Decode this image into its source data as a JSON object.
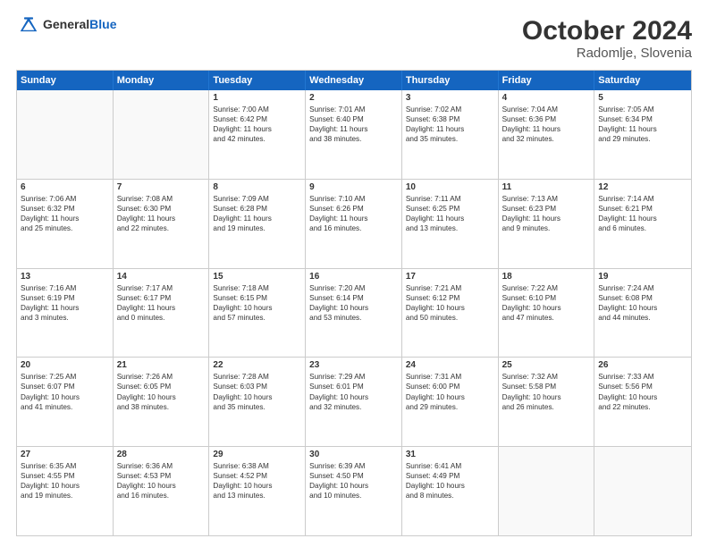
{
  "logo": {
    "general": "General",
    "blue": "Blue"
  },
  "title": "October 2024",
  "location": "Radomlje, Slovenia",
  "header_days": [
    "Sunday",
    "Monday",
    "Tuesday",
    "Wednesday",
    "Thursday",
    "Friday",
    "Saturday"
  ],
  "weeks": [
    [
      {
        "day": "",
        "lines": []
      },
      {
        "day": "",
        "lines": []
      },
      {
        "day": "1",
        "lines": [
          "Sunrise: 7:00 AM",
          "Sunset: 6:42 PM",
          "Daylight: 11 hours",
          "and 42 minutes."
        ]
      },
      {
        "day": "2",
        "lines": [
          "Sunrise: 7:01 AM",
          "Sunset: 6:40 PM",
          "Daylight: 11 hours",
          "and 38 minutes."
        ]
      },
      {
        "day": "3",
        "lines": [
          "Sunrise: 7:02 AM",
          "Sunset: 6:38 PM",
          "Daylight: 11 hours",
          "and 35 minutes."
        ]
      },
      {
        "day": "4",
        "lines": [
          "Sunrise: 7:04 AM",
          "Sunset: 6:36 PM",
          "Daylight: 11 hours",
          "and 32 minutes."
        ]
      },
      {
        "day": "5",
        "lines": [
          "Sunrise: 7:05 AM",
          "Sunset: 6:34 PM",
          "Daylight: 11 hours",
          "and 29 minutes."
        ]
      }
    ],
    [
      {
        "day": "6",
        "lines": [
          "Sunrise: 7:06 AM",
          "Sunset: 6:32 PM",
          "Daylight: 11 hours",
          "and 25 minutes."
        ]
      },
      {
        "day": "7",
        "lines": [
          "Sunrise: 7:08 AM",
          "Sunset: 6:30 PM",
          "Daylight: 11 hours",
          "and 22 minutes."
        ]
      },
      {
        "day": "8",
        "lines": [
          "Sunrise: 7:09 AM",
          "Sunset: 6:28 PM",
          "Daylight: 11 hours",
          "and 19 minutes."
        ]
      },
      {
        "day": "9",
        "lines": [
          "Sunrise: 7:10 AM",
          "Sunset: 6:26 PM",
          "Daylight: 11 hours",
          "and 16 minutes."
        ]
      },
      {
        "day": "10",
        "lines": [
          "Sunrise: 7:11 AM",
          "Sunset: 6:25 PM",
          "Daylight: 11 hours",
          "and 13 minutes."
        ]
      },
      {
        "day": "11",
        "lines": [
          "Sunrise: 7:13 AM",
          "Sunset: 6:23 PM",
          "Daylight: 11 hours",
          "and 9 minutes."
        ]
      },
      {
        "day": "12",
        "lines": [
          "Sunrise: 7:14 AM",
          "Sunset: 6:21 PM",
          "Daylight: 11 hours",
          "and 6 minutes."
        ]
      }
    ],
    [
      {
        "day": "13",
        "lines": [
          "Sunrise: 7:16 AM",
          "Sunset: 6:19 PM",
          "Daylight: 11 hours",
          "and 3 minutes."
        ]
      },
      {
        "day": "14",
        "lines": [
          "Sunrise: 7:17 AM",
          "Sunset: 6:17 PM",
          "Daylight: 11 hours",
          "and 0 minutes."
        ]
      },
      {
        "day": "15",
        "lines": [
          "Sunrise: 7:18 AM",
          "Sunset: 6:15 PM",
          "Daylight: 10 hours",
          "and 57 minutes."
        ]
      },
      {
        "day": "16",
        "lines": [
          "Sunrise: 7:20 AM",
          "Sunset: 6:14 PM",
          "Daylight: 10 hours",
          "and 53 minutes."
        ]
      },
      {
        "day": "17",
        "lines": [
          "Sunrise: 7:21 AM",
          "Sunset: 6:12 PM",
          "Daylight: 10 hours",
          "and 50 minutes."
        ]
      },
      {
        "day": "18",
        "lines": [
          "Sunrise: 7:22 AM",
          "Sunset: 6:10 PM",
          "Daylight: 10 hours",
          "and 47 minutes."
        ]
      },
      {
        "day": "19",
        "lines": [
          "Sunrise: 7:24 AM",
          "Sunset: 6:08 PM",
          "Daylight: 10 hours",
          "and 44 minutes."
        ]
      }
    ],
    [
      {
        "day": "20",
        "lines": [
          "Sunrise: 7:25 AM",
          "Sunset: 6:07 PM",
          "Daylight: 10 hours",
          "and 41 minutes."
        ]
      },
      {
        "day": "21",
        "lines": [
          "Sunrise: 7:26 AM",
          "Sunset: 6:05 PM",
          "Daylight: 10 hours",
          "and 38 minutes."
        ]
      },
      {
        "day": "22",
        "lines": [
          "Sunrise: 7:28 AM",
          "Sunset: 6:03 PM",
          "Daylight: 10 hours",
          "and 35 minutes."
        ]
      },
      {
        "day": "23",
        "lines": [
          "Sunrise: 7:29 AM",
          "Sunset: 6:01 PM",
          "Daylight: 10 hours",
          "and 32 minutes."
        ]
      },
      {
        "day": "24",
        "lines": [
          "Sunrise: 7:31 AM",
          "Sunset: 6:00 PM",
          "Daylight: 10 hours",
          "and 29 minutes."
        ]
      },
      {
        "day": "25",
        "lines": [
          "Sunrise: 7:32 AM",
          "Sunset: 5:58 PM",
          "Daylight: 10 hours",
          "and 26 minutes."
        ]
      },
      {
        "day": "26",
        "lines": [
          "Sunrise: 7:33 AM",
          "Sunset: 5:56 PM",
          "Daylight: 10 hours",
          "and 22 minutes."
        ]
      }
    ],
    [
      {
        "day": "27",
        "lines": [
          "Sunrise: 6:35 AM",
          "Sunset: 4:55 PM",
          "Daylight: 10 hours",
          "and 19 minutes."
        ]
      },
      {
        "day": "28",
        "lines": [
          "Sunrise: 6:36 AM",
          "Sunset: 4:53 PM",
          "Daylight: 10 hours",
          "and 16 minutes."
        ]
      },
      {
        "day": "29",
        "lines": [
          "Sunrise: 6:38 AM",
          "Sunset: 4:52 PM",
          "Daylight: 10 hours",
          "and 13 minutes."
        ]
      },
      {
        "day": "30",
        "lines": [
          "Sunrise: 6:39 AM",
          "Sunset: 4:50 PM",
          "Daylight: 10 hours",
          "and 10 minutes."
        ]
      },
      {
        "day": "31",
        "lines": [
          "Sunrise: 6:41 AM",
          "Sunset: 4:49 PM",
          "Daylight: 10 hours",
          "and 8 minutes."
        ]
      },
      {
        "day": "",
        "lines": []
      },
      {
        "day": "",
        "lines": []
      }
    ]
  ]
}
